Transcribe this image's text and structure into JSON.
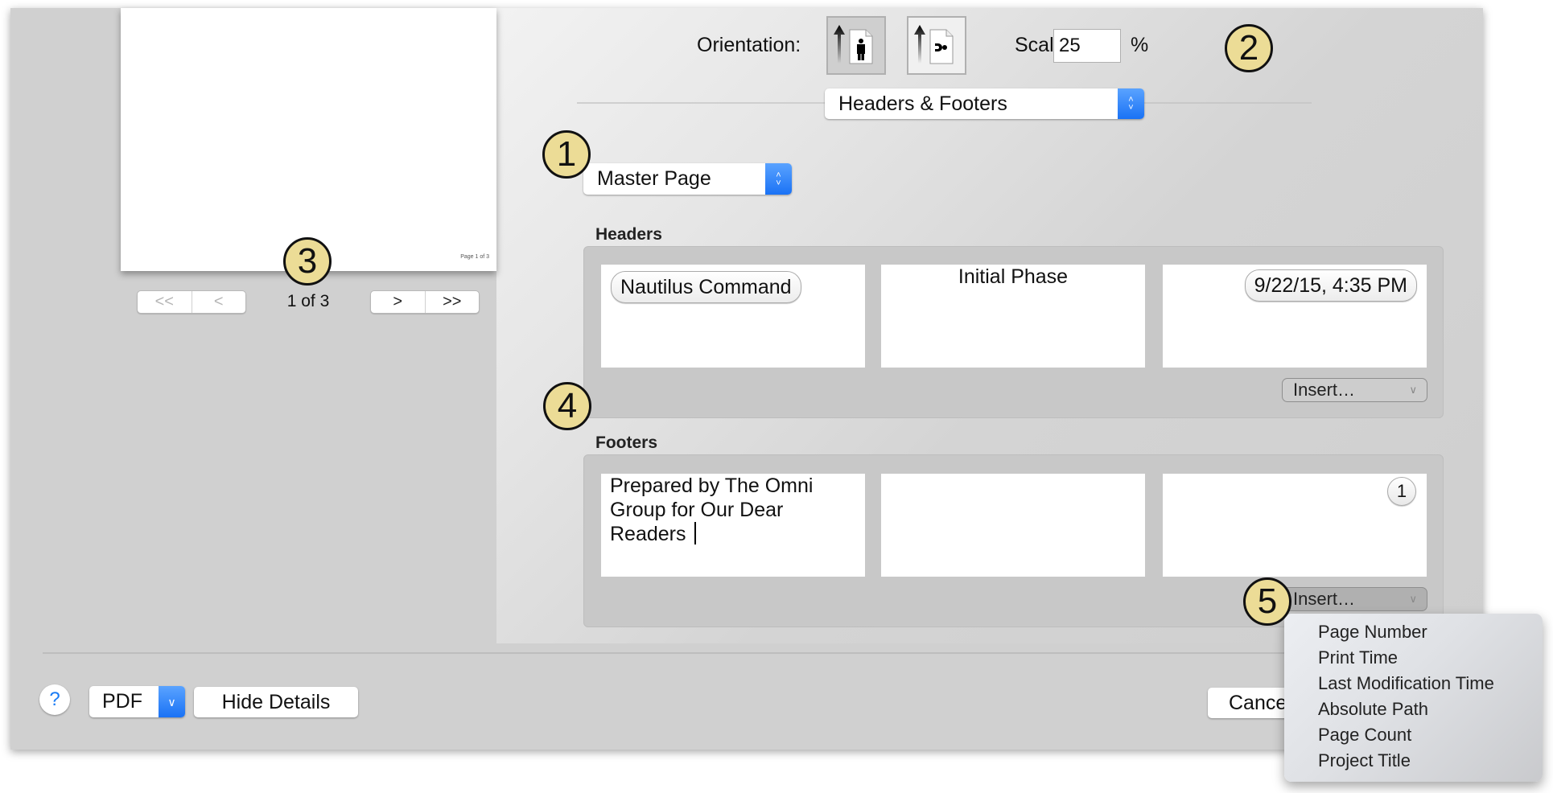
{
  "preview": {
    "page_footer_text": "Page 1 of 3",
    "page_indicator": "1 of 3",
    "nav": {
      "first": "<<",
      "previous": "<",
      "next": ">",
      "last": ">>"
    }
  },
  "top_controls": {
    "orientation_label": "Orientation:",
    "orientation_selected": "portrait",
    "scale_label": "Scale:",
    "scale_value": "25",
    "percent_label": "%"
  },
  "section_popup": {
    "selected": "Headers & Footers"
  },
  "master_popup": {
    "selected": "Master Page"
  },
  "headers": {
    "label": "Headers",
    "left_token": "Nautilus Command",
    "center_text": "Initial Phase",
    "right_token": "9/22/15, 4:35 PM",
    "insert_label": "Insert…"
  },
  "footers": {
    "label": "Footers",
    "left_text": "Prepared by The Omni Group for Our Dear Readers ",
    "center_text": "",
    "right_token": "1",
    "insert_label": "Insert…"
  },
  "insert_menu": {
    "items": [
      "Page Number",
      "Print Time",
      "Last Modification Time",
      "Absolute Path",
      "Page Count",
      "Project Title"
    ]
  },
  "bottom_bar": {
    "help_label": "?",
    "pdf_label": "PDF",
    "hide_details_label": "Hide Details",
    "cancel_label": "Cancel"
  },
  "callouts": [
    "1",
    "2",
    "3",
    "4",
    "5"
  ],
  "colors": {
    "accent_blue": "#1a72f5",
    "callout_fill": "#ecdc96",
    "window_bg": "#d0d0d0"
  }
}
